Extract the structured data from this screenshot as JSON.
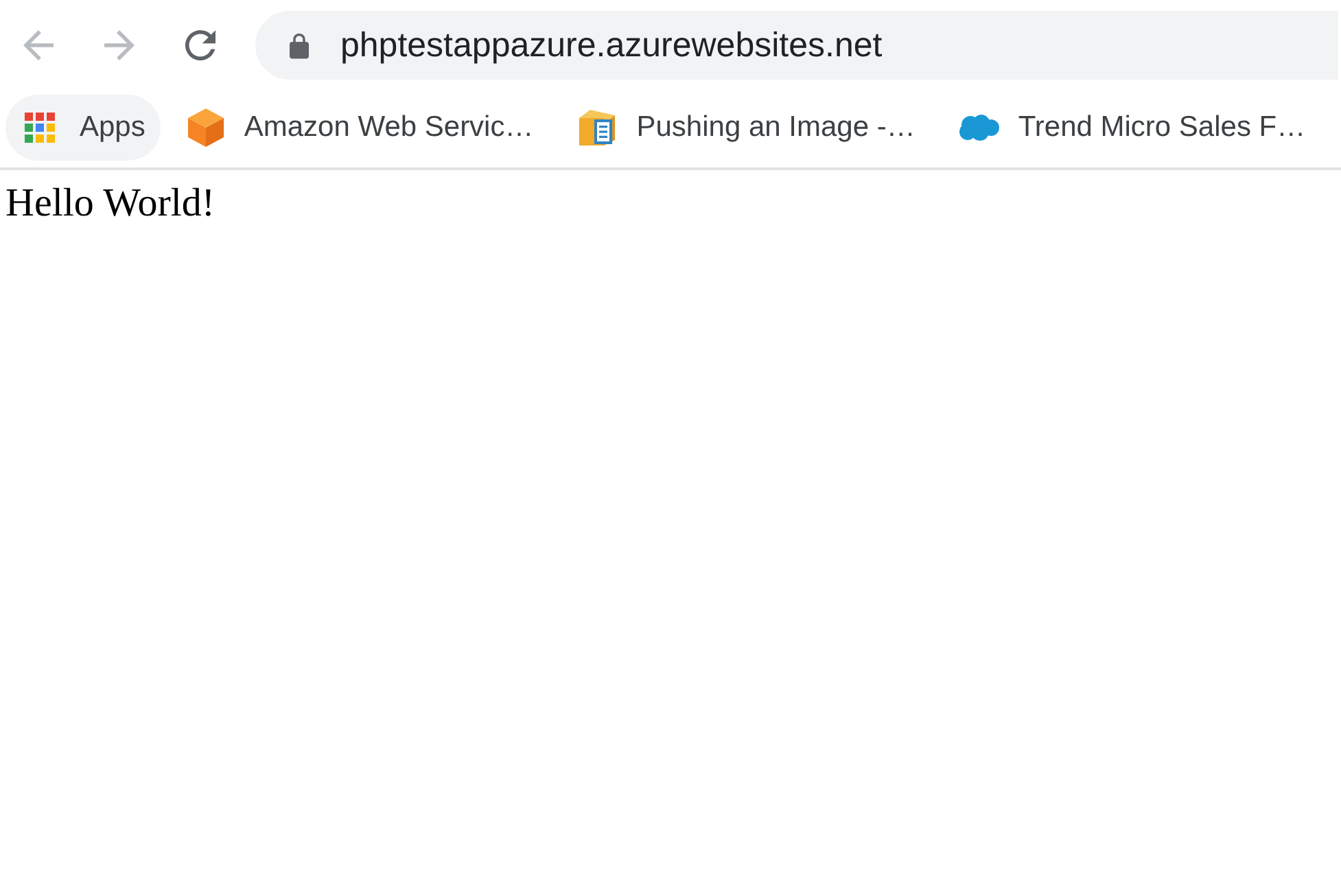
{
  "toolbar": {
    "nav_buttons": [
      {
        "kind": "back",
        "disabled": true
      },
      {
        "kind": "forward",
        "disabled": true
      },
      {
        "kind": "reload",
        "disabled": false
      }
    ],
    "address_bar": {
      "value": "phptestappazure.azurewebsites.net"
    }
  },
  "bookmarks_bar": {
    "apps": {
      "label": "Apps",
      "hovered": true
    },
    "bookmarks": [
      {
        "label": "Amazon Web Servic…"
      },
      {
        "label": "Pushing an Image -…"
      },
      {
        "label": "Trend Micro Sales F…"
      }
    ]
  },
  "page": {
    "text": "Hello World!"
  }
}
